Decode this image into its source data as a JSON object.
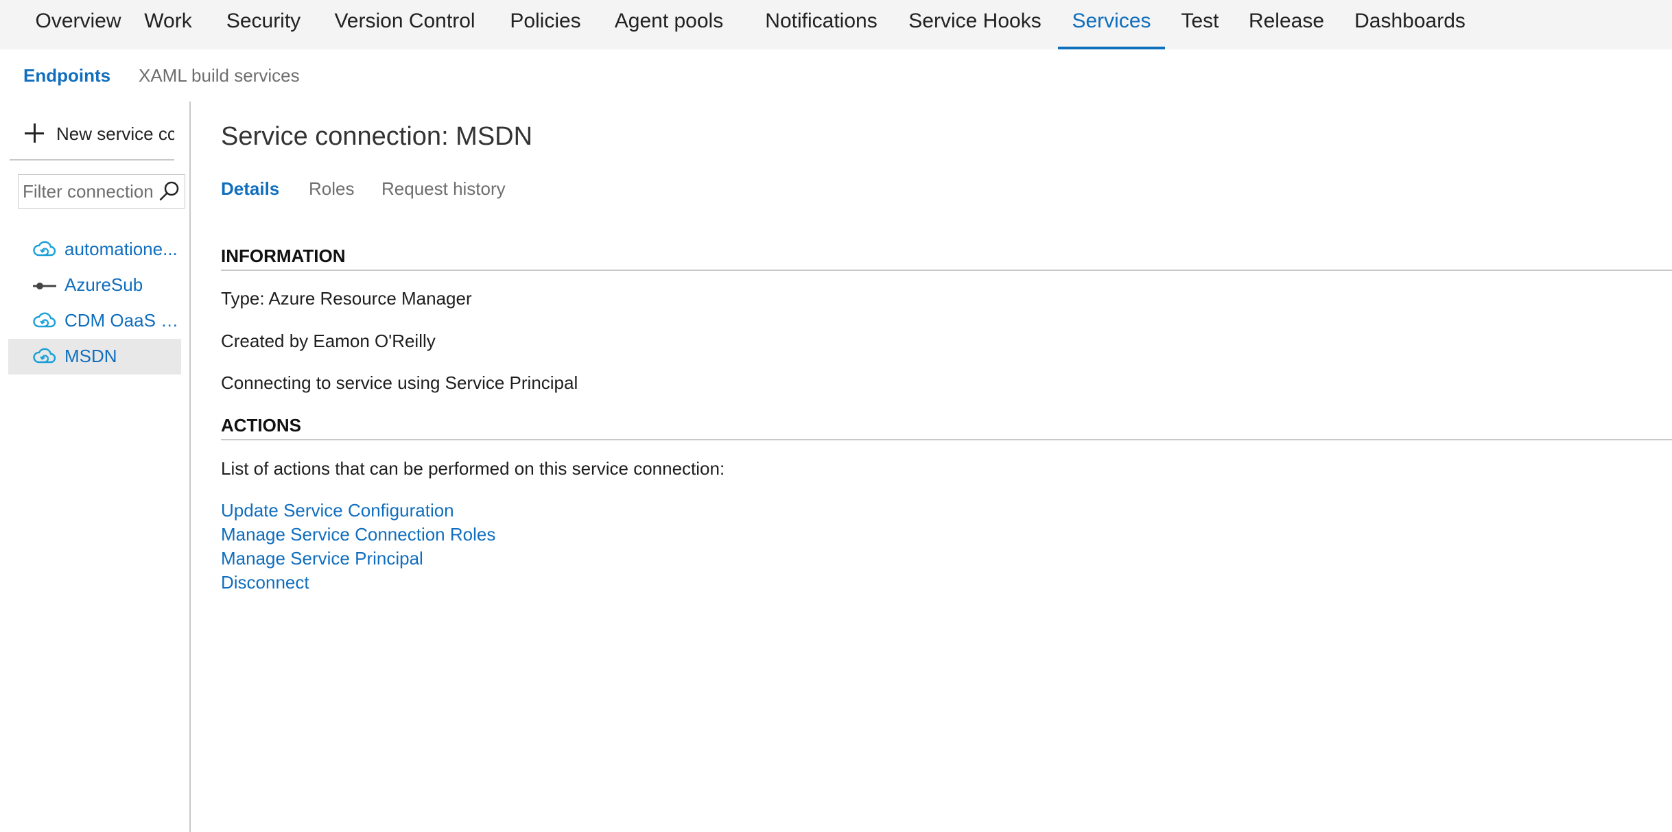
{
  "topnav": {
    "tabs": [
      {
        "label": "Overview"
      },
      {
        "label": "Work"
      },
      {
        "label": "Security"
      },
      {
        "label": "Version Control"
      },
      {
        "label": "Policies"
      },
      {
        "label": "Agent pools"
      },
      {
        "label": "Notifications"
      },
      {
        "label": "Service Hooks"
      },
      {
        "label": "Services"
      },
      {
        "label": "Test"
      },
      {
        "label": "Release"
      },
      {
        "label": "Dashboards"
      }
    ],
    "active": "Services"
  },
  "subnav": {
    "tabs": [
      {
        "label": "Endpoints"
      },
      {
        "label": "XAML build services"
      }
    ],
    "active": "Endpoints"
  },
  "sidebar": {
    "new_button_label": "New service cc",
    "filter_placeholder": "Filter connection",
    "connections": [
      {
        "name": "automatione...",
        "icon": "cloud-sync-icon"
      },
      {
        "name": "AzureSub",
        "icon": "key-connector-icon"
      },
      {
        "name": "CDM OaaS P...",
        "icon": "cloud-sync-icon"
      },
      {
        "name": "MSDN",
        "icon": "cloud-sync-icon"
      }
    ],
    "selected": "MSDN"
  },
  "main": {
    "title": "Service connection: MSDN",
    "tabs": [
      {
        "label": "Details"
      },
      {
        "label": "Roles"
      },
      {
        "label": "Request history"
      }
    ],
    "active_tab": "Details",
    "information_heading": "INFORMATION",
    "information_lines": [
      "Type: Azure Resource Manager",
      "Created by Eamon O'Reilly",
      "Connecting to service using Service Principal"
    ],
    "actions_heading": "ACTIONS",
    "actions_intro": "List of actions that can be performed on this service connection:",
    "actions": [
      "Update Service Configuration",
      "Manage Service Connection Roles",
      "Manage Service Principal",
      "Disconnect"
    ]
  },
  "colors": {
    "accent": "#106ebe",
    "nav_background": "#f4f4f4",
    "selected_row": "#e8e8e8",
    "divider": "#c8c8c8"
  }
}
